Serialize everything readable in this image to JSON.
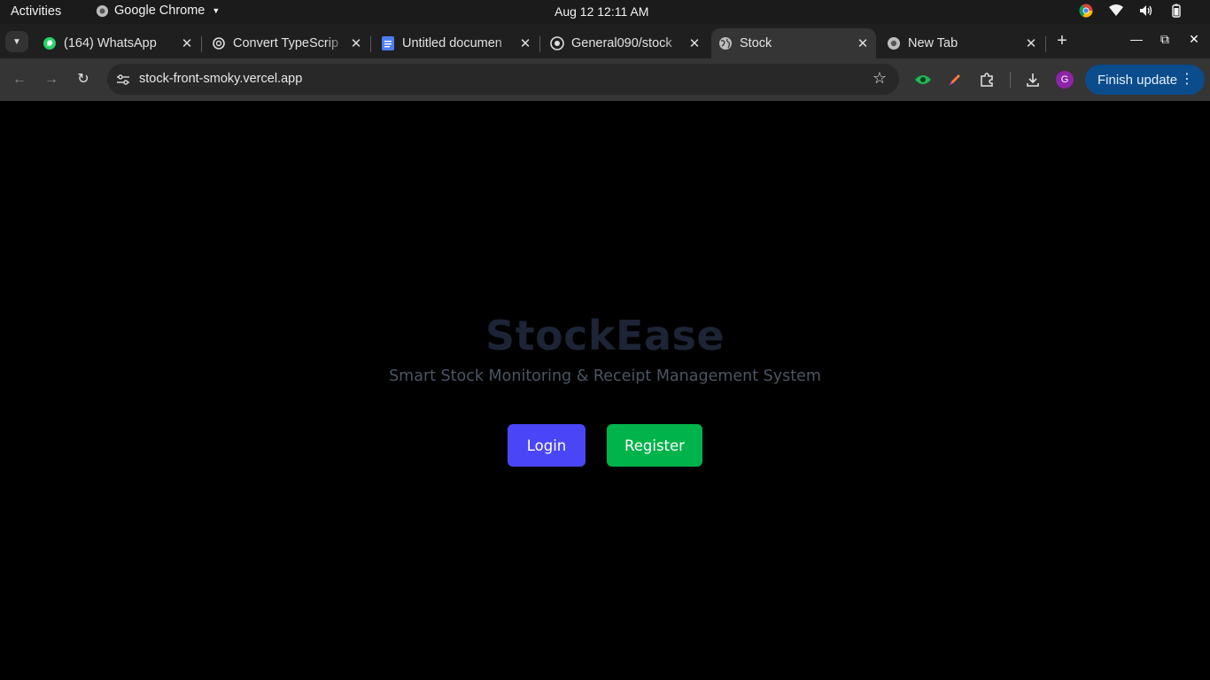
{
  "system": {
    "activities": "Activities",
    "app_name": "Google Chrome",
    "clock": "Aug 12  12:11 AM"
  },
  "tabs": [
    {
      "title": "(164) WhatsApp",
      "icon": "whatsapp-icon"
    },
    {
      "title": "Convert TypeScrip",
      "icon": "chatgpt-icon"
    },
    {
      "title": "Untitled documen",
      "icon": "google-docs-icon"
    },
    {
      "title": "General090/stock",
      "icon": "github-icon"
    },
    {
      "title": "Stock",
      "icon": "globe-icon",
      "active": true
    },
    {
      "title": "New Tab",
      "icon": "chrome-icon"
    }
  ],
  "toolbar": {
    "url": "stock-front-smoky.vercel.app",
    "profile_initial": "G",
    "finish_update": "Finish update"
  },
  "page": {
    "brand": "StockEase",
    "subtitle": "Smart Stock Monitoring & Receipt Management System",
    "login_label": "Login",
    "register_label": "Register"
  },
  "colors": {
    "login_button": "#4a46f7",
    "register_button": "#00b34a",
    "brand_text": "#1c2435",
    "finish_update_bg": "#0b4c8c"
  }
}
